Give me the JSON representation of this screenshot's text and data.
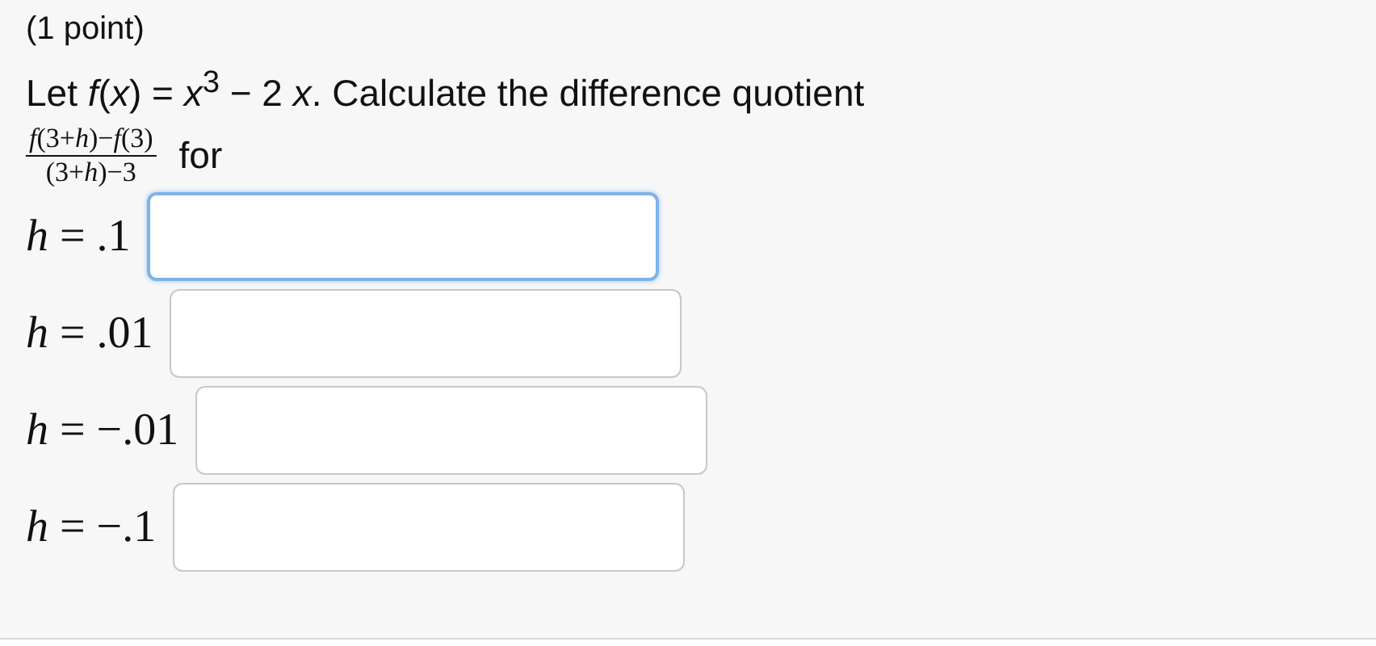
{
  "points": "(1 point)",
  "prompt": "Let *f*(*x*) = *x*$^{3}$ − 2 *x*. Calculate the difference quotient",
  "fraction": {
    "numerator": "*f*(3+*h*)−*f*(3)",
    "denominator": "(3+*h*)−3"
  },
  "fraction_suffix": "for",
  "answers": [
    {
      "label": "*h* = .1",
      "focused": true
    },
    {
      "label": "*h* = .01",
      "focused": false
    },
    {
      "label": "*h* = −.01",
      "focused": false
    },
    {
      "label": "*h* = −.1",
      "focused": false
    }
  ]
}
